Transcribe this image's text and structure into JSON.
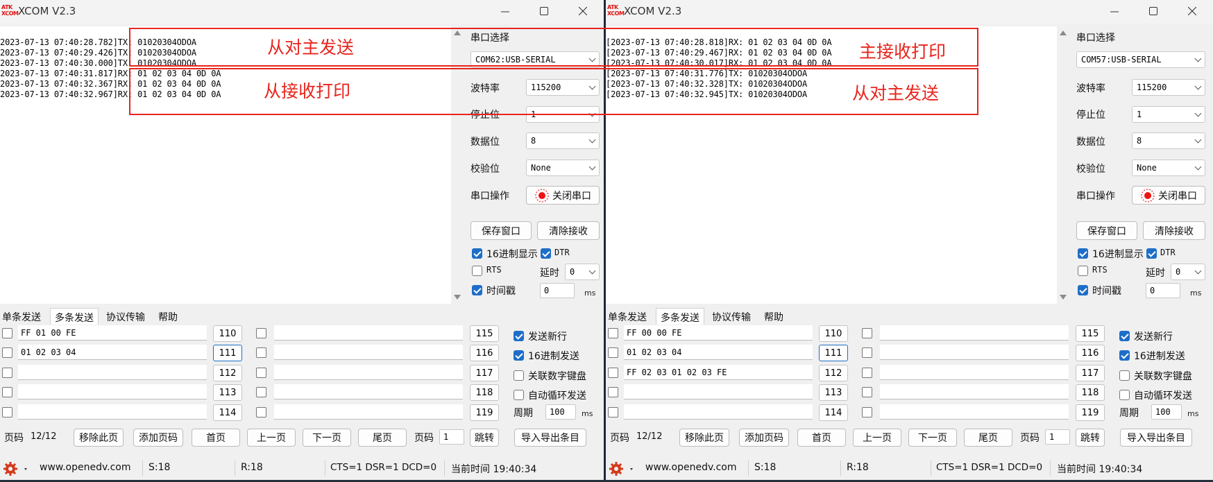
{
  "windows": [
    {
      "title": "XCOM V2.3",
      "logo_top": "ATK",
      "logo_bottom": "XCOM",
      "receive_lines": [
        "2023-07-13 07:40:28.782]TX: 01020304ODOA",
        "2023-07-13 07:40:29.426]TX: 01020304ODOA",
        "2023-07-13 07:40:30.000]TX: 01020304ODOA",
        "2023-07-13 07:40:31.817]RX: 01 02 03 04 0D 0A",
        "2023-07-13 07:40:32.367]RX: 01 02 03 04 0D 0A",
        "2023-07-13 07:40:32.967]RX: 01 02 03 04 0D 0A"
      ],
      "panel": {
        "port_label": "串口选择",
        "port_value": "COM62:USB-SERIAL",
        "baud_label": "波特率",
        "baud_value": "115200",
        "stop_label": "停止位",
        "stop_value": "1",
        "data_label": "数据位",
        "data_value": "8",
        "parity_label": "校验位",
        "parity_value": "None",
        "op_label": "串口操作",
        "op_button": "关闭串口",
        "save_button": "保存窗口",
        "clear_button": "清除接收",
        "hex_display": "16进制显示",
        "dtr": "DTR",
        "rts": "RTS",
        "delay_label": "延时",
        "delay_value": "0",
        "timestamp": "时间戳",
        "timestamp_value": "0",
        "unit": "ms"
      },
      "tabs": [
        "单条发送",
        "多条发送",
        "协议传输",
        "帮助"
      ],
      "multi_rows": [
        {
          "text": "FF 01 00 FE",
          "num": "110"
        },
        {
          "text": "01 02 03 04",
          "num": "111"
        },
        {
          "text": "",
          "num": "112"
        },
        {
          "text": "",
          "num": "113"
        },
        {
          "text": "",
          "num": "114"
        }
      ],
      "multi_rows2": [
        {
          "text": "",
          "num": "115"
        },
        {
          "text": "",
          "num": "116"
        },
        {
          "text": "",
          "num": "117"
        },
        {
          "text": "",
          "num": "118"
        },
        {
          "text": "",
          "num": "119"
        }
      ],
      "options": {
        "send_newline": "发送新行",
        "hex_send": "16进制发送",
        "link_keypad": "关联数字键盘",
        "auto_loop": "自动循环发送",
        "period_label": "周期",
        "period_value": "100",
        "unit": "ms"
      },
      "nav": {
        "page_code_label": "页码",
        "page_code_value": "12/12",
        "remove_page": "移除此页",
        "add_page": "添加页码",
        "first_page": "首页",
        "prev_page": "上一页",
        "next_page": "下一页",
        "last_page": "尾页",
        "page_label": "页码",
        "page_value": "1",
        "jump": "跳转",
        "import_export": "导入导出条目"
      },
      "status": {
        "url": "www.openedv.com",
        "sent": "S:18",
        "recv": "R:18",
        "lines": "CTS=1 DSR=1 DCD=0",
        "time": "当前时间 19:40:34"
      },
      "annotations": [
        "从对主发送",
        "从接收打印"
      ]
    },
    {
      "title": "XCOM V2.3",
      "logo_top": "ATK",
      "logo_bottom": "XCOM",
      "receive_lines": [
        "[2023-07-13 07:40:28.818]RX: 01 02 03 04 0D 0A",
        "[2023-07-13 07:40:29.467]RX: 01 02 03 04 0D 0A",
        "[2023-07-13 07:40:30.017]RX: 01 02 03 04 0D 0A",
        "[2023-07-13 07:40:31.776]TX: 01020304ODOA",
        "[2023-07-13 07:40:32.328]TX: 01020304ODOA",
        "[2023-07-13 07:40:32.945]TX: 01020304ODOA"
      ],
      "panel": {
        "port_label": "串口选择",
        "port_value": "COM57:USB-SERIAL",
        "baud_label": "波特率",
        "baud_value": "115200",
        "stop_label": "停止位",
        "stop_value": "1",
        "data_label": "数据位",
        "data_value": "8",
        "parity_label": "校验位",
        "parity_value": "None",
        "op_label": "串口操作",
        "op_button": "关闭串口",
        "save_button": "保存窗口",
        "clear_button": "清除接收",
        "hex_display": "16进制显示",
        "dtr": "DTR",
        "rts": "RTS",
        "delay_label": "延时",
        "delay_value": "0",
        "timestamp": "时间戳",
        "timestamp_value": "0",
        "unit": "ms"
      },
      "tabs": [
        "单条发送",
        "多条发送",
        "协议传输",
        "帮助"
      ],
      "multi_rows": [
        {
          "text": "FF 00 00 FE",
          "num": "110"
        },
        {
          "text": "01 02 03 04",
          "num": "111"
        },
        {
          "text": "FF 02 03 01 02 03 FE",
          "num": "112"
        },
        {
          "text": "",
          "num": "113"
        },
        {
          "text": "",
          "num": "114"
        }
      ],
      "multi_rows2": [
        {
          "text": "",
          "num": "115"
        },
        {
          "text": "",
          "num": "116"
        },
        {
          "text": "",
          "num": "117"
        },
        {
          "text": "",
          "num": "118"
        },
        {
          "text": "",
          "num": "119"
        }
      ],
      "options": {
        "send_newline": "发送新行",
        "hex_send": "16进制发送",
        "link_keypad": "关联数字键盘",
        "auto_loop": "自动循环发送",
        "period_label": "周期",
        "period_value": "100",
        "unit": "ms"
      },
      "nav": {
        "page_code_label": "页码",
        "page_code_value": "12/12",
        "remove_page": "移除此页",
        "add_page": "添加页码",
        "first_page": "首页",
        "prev_page": "上一页",
        "next_page": "下一页",
        "last_page": "尾页",
        "page_label": "页码",
        "page_value": "1",
        "jump": "跳转",
        "import_export": "导入导出条目"
      },
      "status": {
        "url": "www.openedv.com",
        "sent": "S:18",
        "recv": "R:18",
        "lines": "CTS=1 DSR=1 DCD=0",
        "time": "当前时间 19:40:34"
      },
      "annotations": [
        "主接收打印",
        "从对主发送"
      ]
    }
  ],
  "colors": {
    "annotation_red": "#e8241c",
    "check_blue": "#1e6ec8"
  },
  "icons": [
    "minimize-icon",
    "maximize-icon",
    "close-icon",
    "gear-icon",
    "record-icon",
    "chevron-down-icon"
  ]
}
